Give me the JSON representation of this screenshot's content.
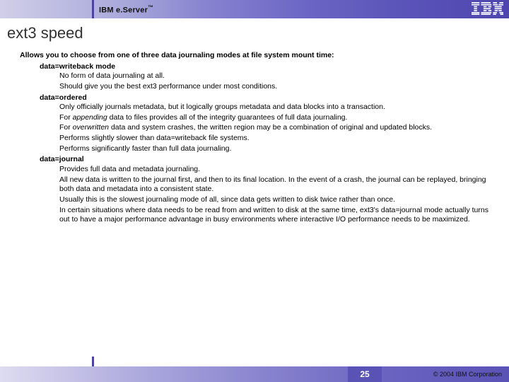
{
  "header": {
    "brand_prefix": "IBM e.Server",
    "brand_tm": "™",
    "logo_name": "IBM"
  },
  "title": "ext3 speed",
  "intro": "Allows you to choose from one of three data journaling modes at file system mount time:",
  "modes": {
    "writeback": {
      "heading": "data=writeback mode",
      "lines": [
        "No form of data journaling at all.",
        "Should give you the best ext3 performance under most conditions."
      ]
    },
    "ordered": {
      "heading": "data=ordered",
      "lines": [
        "Only officially journals metadata, but it logically groups metadata and data blocks into a transaction.",
        "For appending data to files provides all of the integrity guarantees of full data journaling.",
        "For overwritten data and system crashes, the written region may be a combination of original and updated blocks.",
        "Performs slightly slower than data=writeback file systems.",
        "Performs significantly faster than full data journaling."
      ]
    },
    "journal": {
      "heading": "data=journal",
      "lines": [
        "Provides full data and metadata journaling.",
        "All new data is written to the journal first, and then to its final location. In the event of a crash, the journal can be replayed, bringing both data and metadata into a consistent state.",
        "Usually this is the slowest journaling mode of all, since data gets written to disk twice rather than once.",
        "In certain situations where data needs to be read from and written to disk at the same time, ext3's data=journal mode actually turns out to have a major performance advantage in busy environments where interactive I/O performance needs to be maximized."
      ]
    }
  },
  "footer": {
    "page": "25",
    "copyright": "© 2004 IBM Corporation"
  }
}
